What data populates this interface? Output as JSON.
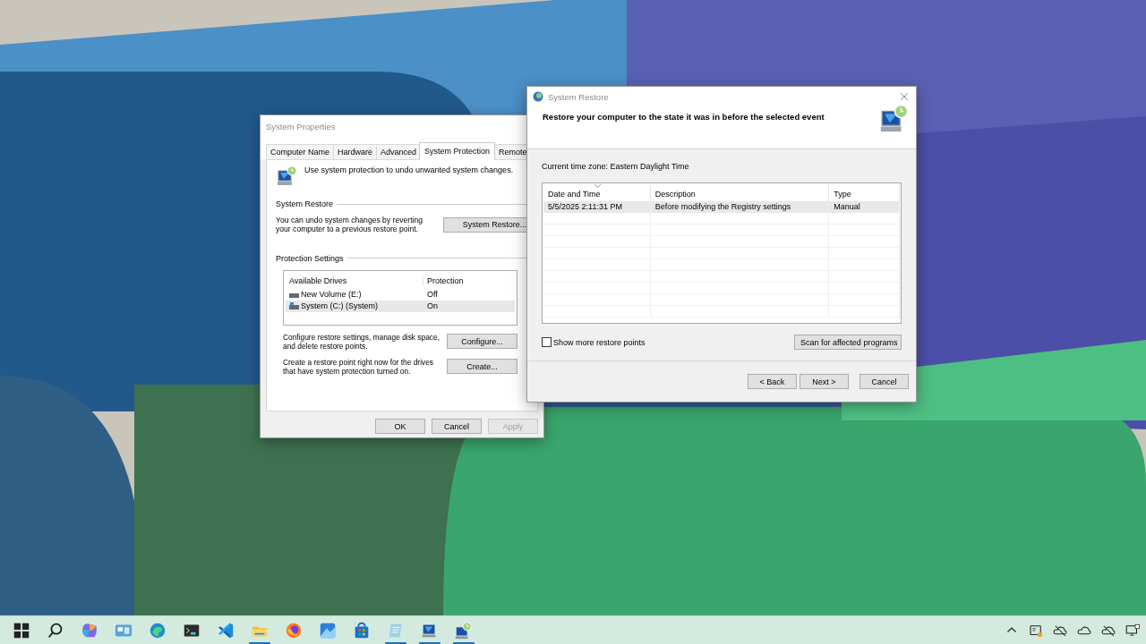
{
  "system_properties": {
    "title": "System Properties",
    "tabs": [
      {
        "label": "Computer Name",
        "selected": false
      },
      {
        "label": "Hardware",
        "selected": false
      },
      {
        "label": "Advanced",
        "selected": false
      },
      {
        "label": "System Protection",
        "selected": true
      },
      {
        "label": "Remote",
        "selected": false
      }
    ],
    "intro": "Use system protection to undo unwanted system changes.",
    "restore_section": {
      "heading": "System Restore",
      "text": "You can undo system changes by reverting your computer to a previous restore point.",
      "button": "System Restore..."
    },
    "protection_section": {
      "heading": "Protection Settings",
      "columns": [
        "Available Drives",
        "Protection"
      ],
      "drives": [
        {
          "name": "New Volume (E:)",
          "protection": "Off",
          "kind": "data",
          "selected": false
        },
        {
          "name": "System (C:) (System)",
          "protection": "On",
          "kind": "system",
          "selected": true
        }
      ]
    },
    "actions": [
      {
        "text": "Configure restore settings, manage disk space, and delete restore points.",
        "button": "Configure..."
      },
      {
        "text": "Create a restore point right now for the drives that have system protection turned on.",
        "button": "Create..."
      }
    ],
    "buttons": [
      {
        "label": "OK",
        "disabled": false
      },
      {
        "label": "Cancel",
        "disabled": false
      },
      {
        "label": "Apply",
        "disabled": true
      }
    ]
  },
  "system_restore": {
    "title": "System Restore",
    "heading": "Restore your computer to the state it was in before the selected event",
    "timezone": "Current time zone: Eastern Daylight Time",
    "columns": [
      "Date and Time",
      "Description",
      "Type"
    ],
    "rows": [
      {
        "cells": [
          "5/5/2025 2:11:31 PM",
          "Before modifying the Registry settings",
          "Manual"
        ],
        "selected": true
      }
    ],
    "show_more": {
      "label": "Show more restore points",
      "checked": false
    },
    "scan_button": "Scan for affected programs",
    "buttons": [
      "< Back",
      "Next >",
      "Cancel"
    ]
  },
  "taskbar": {
    "apps": [
      {
        "kind": "start",
        "running": false
      },
      {
        "kind": "search",
        "running": false
      },
      {
        "kind": "swirl",
        "running": false
      },
      {
        "kind": "widgets",
        "running": false
      },
      {
        "kind": "browser",
        "running": false
      },
      {
        "kind": "terminal",
        "running": false
      },
      {
        "kind": "code",
        "running": false
      },
      {
        "kind": "folder",
        "running": true
      },
      {
        "kind": "globe",
        "running": false
      },
      {
        "kind": "photos",
        "running": false
      },
      {
        "kind": "store",
        "running": false
      },
      {
        "kind": "notepad",
        "running": true
      },
      {
        "kind": "computer",
        "running": true
      },
      {
        "kind": "restore",
        "running": true
      }
    ],
    "tray": [
      {
        "kind": "chevron"
      },
      {
        "kind": "screen-badge"
      },
      {
        "kind": "cloud-off"
      },
      {
        "kind": "cloud"
      },
      {
        "kind": "cloud-off"
      },
      {
        "kind": "monitor"
      }
    ]
  }
}
